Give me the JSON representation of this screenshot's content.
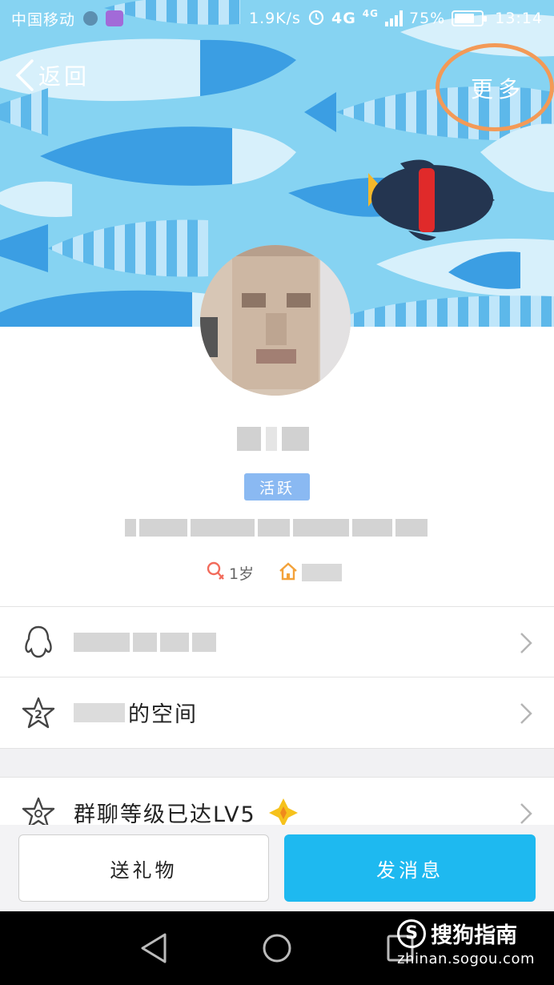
{
  "status_bar": {
    "carrier": "中国移动",
    "net_speed": "1.9K/s",
    "network": "4G",
    "network2": "4G",
    "battery": "75%",
    "battery_level": 0.75,
    "time": "13:14"
  },
  "nav": {
    "back_label": "返回",
    "more_label": "更多"
  },
  "profile": {
    "badge": "活跃",
    "age": "1岁"
  },
  "rows": {
    "space_suffix": "的空间",
    "group_level": "群聊等级已达LV5"
  },
  "actions": {
    "gift_label": "送礼物",
    "message_label": "发消息"
  },
  "watermark": {
    "brand": "搜狗指南",
    "url": "zhinan.sogou.com"
  },
  "colors": {
    "banner_bg": "#86d3f2",
    "accent_blue": "#1eb9f0",
    "highlight_ring": "#f39a57",
    "badge_bg": "#8ab9f2"
  }
}
